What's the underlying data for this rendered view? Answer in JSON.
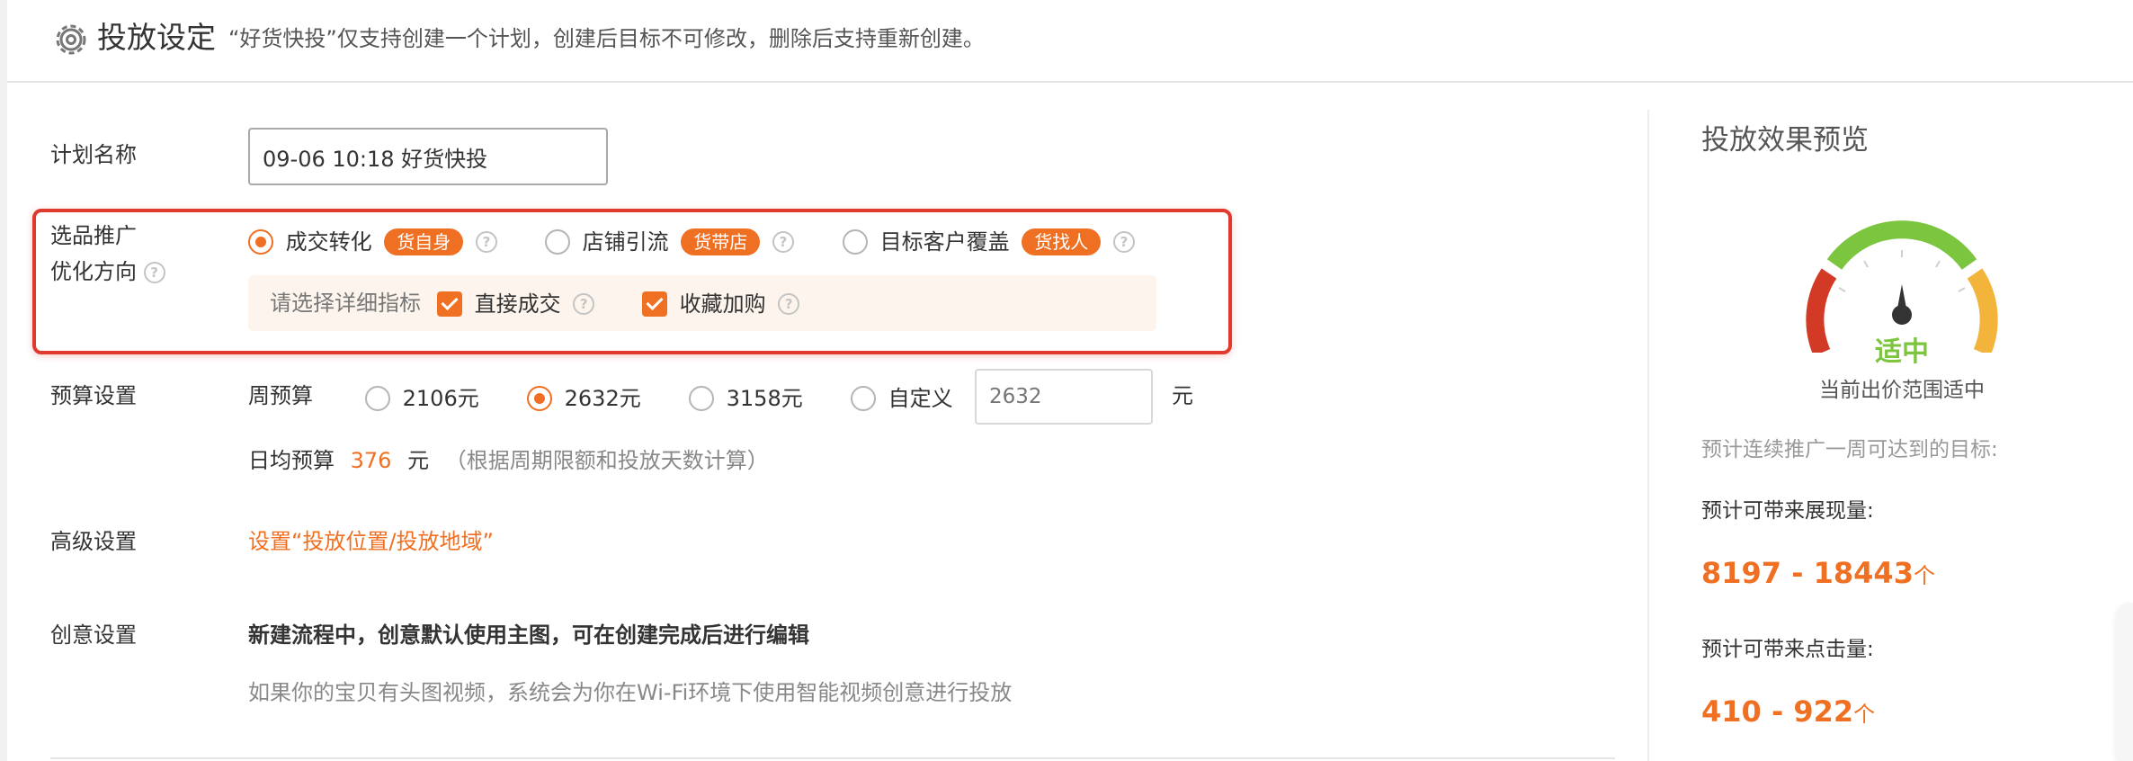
{
  "header": {
    "title": "投放设定",
    "note": "“好货快投”仅支持创建一个计划，创建后目标不可修改，删除后支持重新创建。",
    "icon": "gear-settings-icon"
  },
  "plan_name": {
    "label": "计划名称",
    "value": "09-06 10:18 好货快投"
  },
  "optimization": {
    "label_line1": "选品推广",
    "label_line2": "优化方向",
    "help": "?",
    "options": [
      {
        "label": "成交转化",
        "badge": "货自身",
        "selected": true
      },
      {
        "label": "店铺引流",
        "badge": "货带店",
        "selected": false
      },
      {
        "label": "目标客户覆盖",
        "badge": "货找人",
        "selected": false
      }
    ],
    "detail_hint": "请选择详细指标",
    "metrics": [
      {
        "label": "直接成交",
        "checked": true
      },
      {
        "label": "收藏加购",
        "checked": true
      }
    ]
  },
  "budget": {
    "label": "预算设置",
    "weekly_label": "周预算",
    "options": [
      {
        "label": "2106元",
        "selected": false
      },
      {
        "label": "2632元",
        "selected": true
      },
      {
        "label": "3158元",
        "selected": false
      },
      {
        "label": "自定义",
        "selected": false
      }
    ],
    "custom_placeholder": "2632",
    "unit": "元",
    "daily_label": "日均预算",
    "daily_value": "376",
    "daily_unit": "元",
    "daily_note": "（根据周期限额和投放天数计算）"
  },
  "advanced": {
    "label": "高级设置",
    "link": "设置“投放位置/投放地域”"
  },
  "creative": {
    "label": "创意设置",
    "bold_text": "新建流程中，创意默认使用主图，可在创建完成后进行编辑",
    "note": "如果你的宝贝有头图视频，系统会为你在Wi-Fi环境下使用智能视频创意进行投放"
  },
  "preview": {
    "title": "投放效果预览",
    "gauge_status": "适中",
    "gauge_level": 0.5,
    "gauge_desc": "当前出价范围适中",
    "forecast_note": "预计连续推广一周可达到的目标:",
    "impressions_label": "预计可带来展现量:",
    "impressions_value": "8197 - 18443",
    "impressions_unit": "个",
    "clicks_label": "预计可带来点击量:",
    "clicks_value": "410 - 922",
    "clicks_unit": "个"
  },
  "colors": {
    "accent": "#f07023",
    "highlight_border": "#e03a2e",
    "gauge_green": "#7cc53f",
    "gauge_red": "#d23a26",
    "gauge_yellow": "#f2b43a"
  }
}
